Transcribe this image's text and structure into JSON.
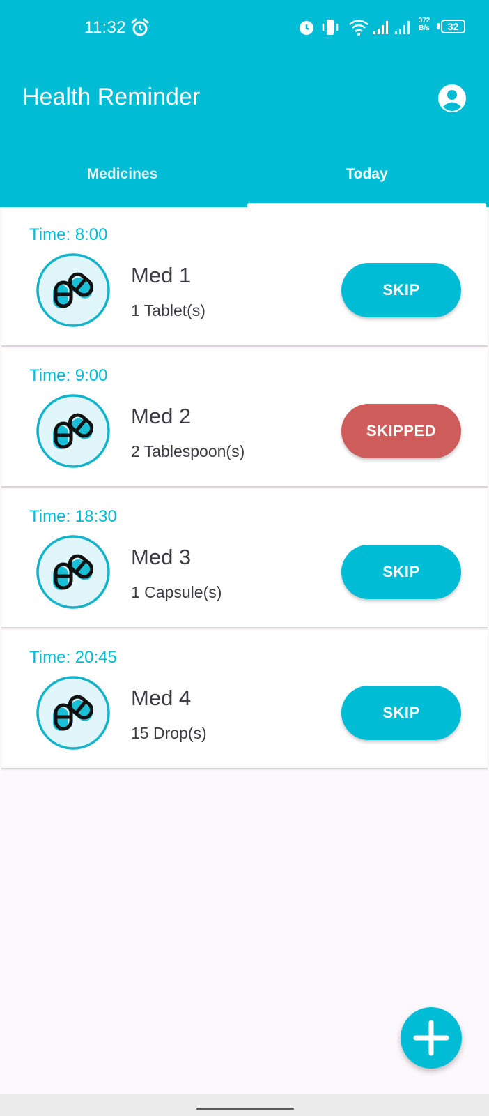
{
  "status_bar": {
    "time": "11:32",
    "network_speed_value": "372",
    "network_speed_unit": "B/s",
    "battery": "32",
    "icons": [
      "alarm-clock-icon",
      "alarm-icon",
      "vibrate-icon",
      "wifi-icon",
      "signal-icon",
      "signal-icon",
      "battery-icon"
    ]
  },
  "header": {
    "title": "Health Reminder",
    "account_icon": "account-circle-icon"
  },
  "tabs": [
    {
      "label": "Medicines",
      "selected": false
    },
    {
      "label": "Today",
      "selected": true
    }
  ],
  "reminders": [
    {
      "time": "Time: 8:00",
      "name": "Med 1",
      "dose": "1 Tablet(s)",
      "action": "SKIP",
      "status": "pending"
    },
    {
      "time": "Time: 9:00",
      "name": "Med 2",
      "dose": "2 Tablespoon(s)",
      "action": "SKIPPED",
      "status": "skipped"
    },
    {
      "time": "Time: 18:30",
      "name": "Med 3",
      "dose": "1 Capsule(s)",
      "action": "SKIP",
      "status": "pending"
    },
    {
      "time": "Time: 20:45",
      "name": "Med 4",
      "dose": "15 Drop(s)",
      "action": "SKIP",
      "status": "pending"
    }
  ],
  "fab": {
    "icon": "plus-icon"
  },
  "colors": {
    "primary": "#00bcd4",
    "skipped": "#cd5c5a",
    "text": "#3c3c44",
    "background": "#fdf8fc"
  }
}
